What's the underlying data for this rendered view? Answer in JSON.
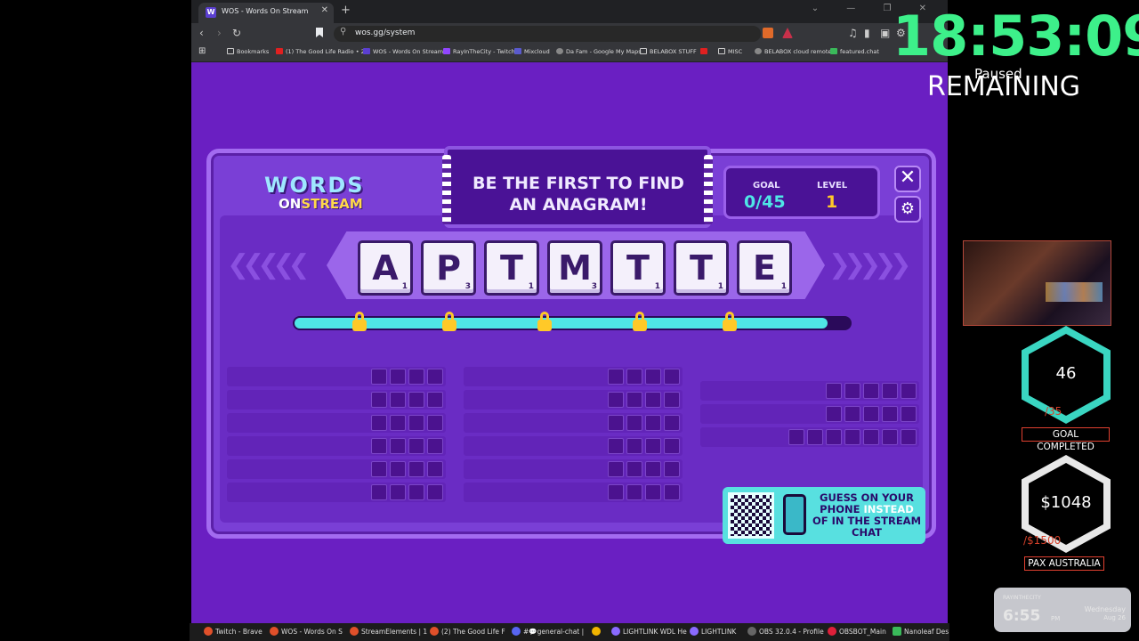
{
  "browser": {
    "tab_title": "WOS - Words On Stream",
    "tab_favicon": "W",
    "new_tab": "+",
    "url": "wos.gg/system",
    "bookmarks": [
      "Bookmarks",
      "(1) The Good Life Radio • 2...",
      "WOS - Words On Stream",
      "RayInTheCity - Twitch",
      "Mixcloud",
      "Da Fam - Google My Maps",
      "BELABOX STUFF",
      "MISC",
      "BELABOX cloud remote",
      "featured.chat"
    ]
  },
  "game": {
    "logo_line1": "WORDS",
    "logo_on": "ON",
    "logo_stream": "STREAM",
    "banner": "BE THE FIRST TO FIND AN ANAGRAM!",
    "goal_label": "GOAL",
    "goal_value": "0/45",
    "level_label": "LEVEL",
    "level_value": "1",
    "tiles": [
      {
        "letter": "A",
        "score": "1"
      },
      {
        "letter": "P",
        "score": "3"
      },
      {
        "letter": "T",
        "score": "1"
      },
      {
        "letter": "M",
        "score": "3"
      },
      {
        "letter": "T",
        "score": "1"
      },
      {
        "letter": "T",
        "score": "1"
      },
      {
        "letter": "E",
        "score": "1"
      }
    ],
    "progress_fraction": 0.96,
    "qr_text_1": "GUESS ON YOUR PHONE",
    "qr_text_2": "INSTEAD",
    "qr_text_3": "OF IN THE STREAM CHAT"
  },
  "overlay": {
    "timer": "18:53:09",
    "paused": "Paused",
    "remaining": "REMAINING",
    "counter_value": "46",
    "counter_goal": "/35",
    "counter_badge": "GOAL COMPLETED",
    "money_value": "$1048",
    "money_goal": "/$1500",
    "money_badge": "PAX AUSTRALIA",
    "clock_brand": "RAYINTHECITY",
    "clock_time": "6:55",
    "clock_ampm": "PM",
    "clock_day": "Wednesday",
    "clock_date": "Aug 26"
  },
  "taskbar": [
    "Twitch - Brave",
    "WOS - Words On S",
    "StreamElements | 1",
    "(2) The Good Life F",
    "#💬general-chat |",
    "LIGHTLINK WDL He",
    "LIGHTLINK",
    "OBS 32.0.4 - Profile",
    "OBSBOT_Main",
    "Nanoleaf Des"
  ],
  "colors": {
    "timer": "#3df08a",
    "game_bg": "#6a1fc2",
    "accent_cyan": "#58e0e0",
    "badge_border": "#e04030"
  }
}
